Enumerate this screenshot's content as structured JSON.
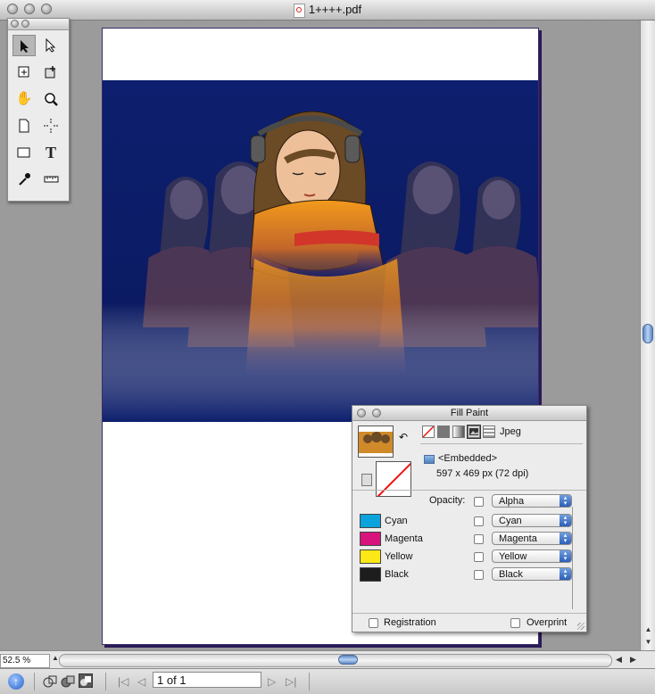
{
  "window": {
    "title": "1++++.pdf"
  },
  "toolbox": {
    "tools": [
      {
        "name": "selection-tool",
        "icon": "black-arrow"
      },
      {
        "name": "direct-selection-tool",
        "icon": "white-arrow"
      },
      {
        "name": "scale-tool",
        "icon": "scale-box"
      },
      {
        "name": "object-transform-tool",
        "icon": "transform-box"
      },
      {
        "name": "pan-tool",
        "icon": "hand"
      },
      {
        "name": "zoom-tool",
        "icon": "magnifier"
      },
      {
        "name": "page-tool",
        "icon": "page"
      },
      {
        "name": "crop-tool",
        "icon": "crop-marks"
      },
      {
        "name": "rectangle-tool",
        "icon": "rectangle"
      },
      {
        "name": "text-tool",
        "icon": "T"
      },
      {
        "name": "eyedropper-tool",
        "icon": "eyedropper"
      },
      {
        "name": "measure-tool",
        "icon": "ruler"
      }
    ],
    "text_tool_glyph": "T"
  },
  "zoom": {
    "value": "52.5 %"
  },
  "navigation": {
    "page_indicator": "1 of 1"
  },
  "fill_panel": {
    "title": "Fill Paint",
    "paint_type_label": "Jpeg",
    "image_source": "<Embedded>",
    "image_size": "597 x 469 px (72 dpi)",
    "opacity_label": "Opacity:",
    "opacity_channel": "Alpha",
    "channels": [
      {
        "label": "Cyan",
        "color": "#0aa3dc",
        "mapping": "Cyan"
      },
      {
        "label": "Magenta",
        "color": "#d8137c",
        "mapping": "Magenta"
      },
      {
        "label": "Yellow",
        "color": "#fbe816",
        "mapping": "Yellow"
      },
      {
        "label": "Black",
        "color": "#1d1d1d",
        "mapping": "Black"
      }
    ],
    "registration_label": "Registration",
    "overprint_label": "Overprint"
  },
  "colors": {
    "artwork_background": "#0d1f6e",
    "scroll_thumb": "#5b88c8"
  }
}
